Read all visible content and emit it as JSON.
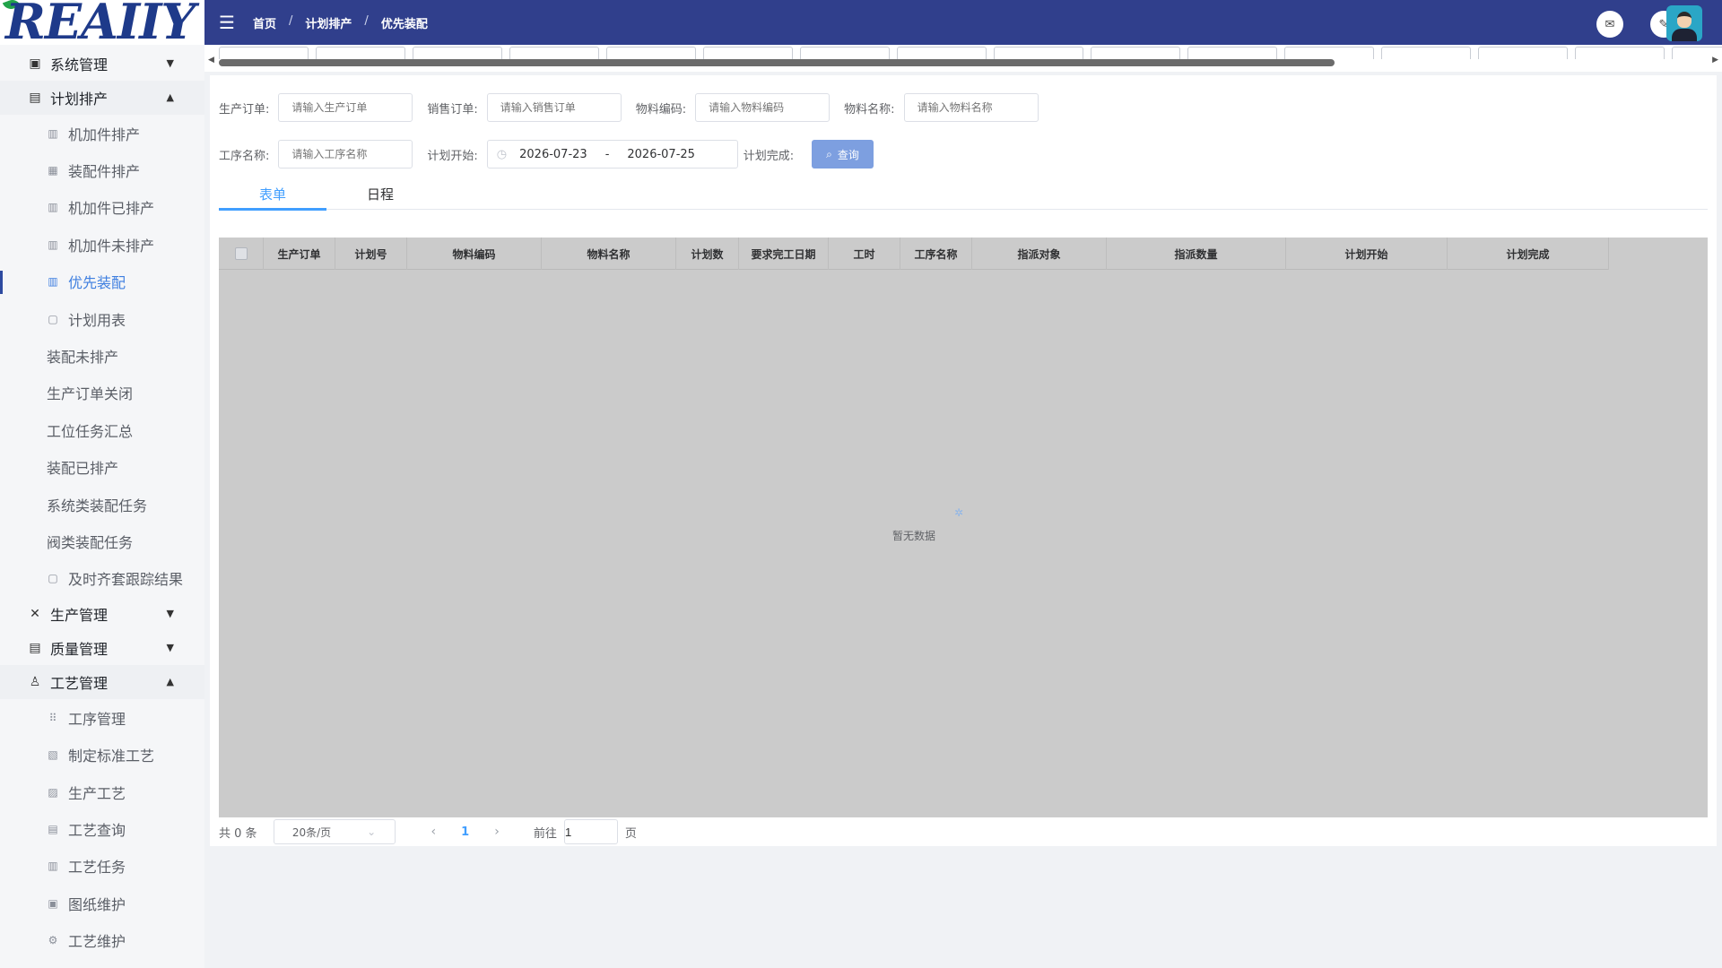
{
  "logo": {
    "text": "REAIIY"
  },
  "sidebar": {
    "groups": [
      {
        "label": "系统管理",
        "icon": "monitor-icon",
        "state": "collapsed"
      },
      {
        "label": "计划排产",
        "icon": "clipboard-icon",
        "state": "expanded",
        "items": [
          "机加件排产",
          "装配件排产",
          "机加件已排产",
          "机加件未排产",
          "优先装配",
          "计划用表",
          "装配未排产",
          "生产订单关闭",
          "工位任务汇总",
          "装配已排产",
          "系统类装配任务",
          "阀类装配任务",
          "及时齐套跟踪结果"
        ]
      },
      {
        "label": "生产管理",
        "icon": "tools-icon",
        "state": "collapsed"
      },
      {
        "label": "质量管理",
        "icon": "document-icon",
        "state": "collapsed"
      },
      {
        "label": "工艺管理",
        "icon": "flask-icon",
        "state": "expanded",
        "items": [
          "工序管理",
          "制定标准工艺",
          "生产工艺",
          "工艺查询",
          "工艺任务",
          "图纸维护",
          "工艺维护"
        ]
      }
    ],
    "active_item": "优先装配"
  },
  "header": {
    "breadcrumb": [
      "首页",
      "计划排产",
      "优先装配"
    ],
    "separator": "/"
  },
  "filters": {
    "prod_order": {
      "label": "生产订单:",
      "placeholder": "请输入生产订单"
    },
    "sales_order": {
      "label": "销售订单:",
      "placeholder": "请输入销售订单"
    },
    "material_code": {
      "label": "物料编码:",
      "placeholder": "请输入物料编码"
    },
    "material_name": {
      "label": "物料名称:",
      "placeholder": "请输入物料名称"
    },
    "process_name": {
      "label": "工序名称:",
      "placeholder": "请输入工序名称"
    },
    "plan_start": {
      "label": "计划开始:",
      "from": "2026-07-23",
      "sep": "-",
      "to": "2026-07-25"
    },
    "plan_finish": {
      "label": "计划完成:"
    },
    "search_label": "查询"
  },
  "view_tabs": [
    "表单",
    "日程"
  ],
  "table": {
    "columns": [
      "生产订单",
      "计划号",
      "物料编码",
      "物料名称",
      "计划数",
      "要求完工日期",
      "工时",
      "工序名称",
      "指派对象",
      "指派数量",
      "计划开始",
      "计划完成"
    ],
    "empty_text": "暂无数据"
  },
  "pager": {
    "total": "共 0 条",
    "page_size": "20条/页",
    "current": "1",
    "goto_label": "前往",
    "goto_value": "1",
    "page_suffix": "页"
  },
  "colors": {
    "header_bg": "#303f8c",
    "accent": "#409eff",
    "button": "#7d9fe0"
  }
}
